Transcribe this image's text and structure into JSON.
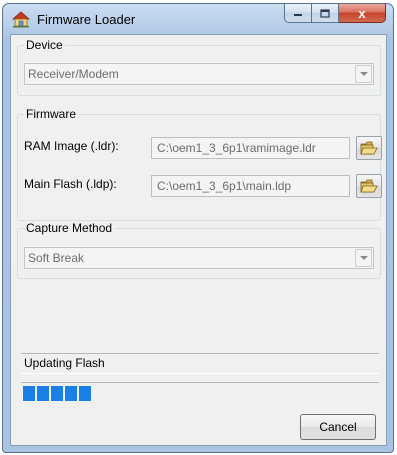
{
  "window": {
    "title": "Firmware Loader",
    "icon": "firmware-loader-icon",
    "caption_buttons": {
      "minimize": "minimize-icon",
      "maximize": "maximize-icon",
      "close": "x"
    }
  },
  "device": {
    "legend": "Device",
    "selected": "Receiver/Modem"
  },
  "firmware": {
    "legend": "Firmware",
    "ram_image": {
      "label": "RAM Image (.ldr):",
      "value": "C:\\oem1_3_6p1\\ramimage.ldr",
      "button_icon": "folder-open-icon"
    },
    "main_flash": {
      "label": "Main Flash (.ldp):",
      "value": "C:\\oem1_3_6p1\\main.ldp",
      "button_icon": "folder-open-icon"
    }
  },
  "capture": {
    "legend": "Capture Method",
    "selected": "Soft Break"
  },
  "status": {
    "text": "Updating Flash",
    "progress_blocks": 5
  },
  "buttons": {
    "cancel": "Cancel"
  },
  "colors": {
    "progress": "#1a7fe6",
    "close_button": "#c4432c",
    "window_frame": "#aac4e3"
  }
}
